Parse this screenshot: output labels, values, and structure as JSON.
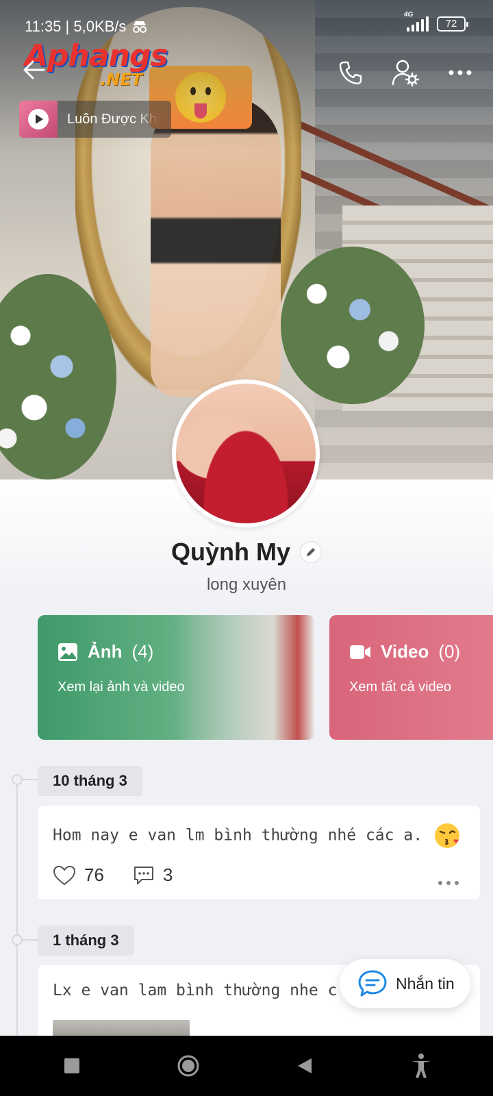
{
  "status_bar": {
    "time_speed": "11:35 | 5,0KB/s",
    "network": "4G",
    "battery": "72"
  },
  "header": {
    "logo_main": "Aphangs",
    "logo_sub": ".NET",
    "music_title": "Luôn Được Khi"
  },
  "profile": {
    "name": "Quỳnh My",
    "location": "long xuyên"
  },
  "cards": {
    "photos": {
      "title": "Ảnh",
      "count": "(4)",
      "subtitle": "Xem lại ảnh và video"
    },
    "videos": {
      "title": "Video",
      "count": "(0)",
      "subtitle": "Xem tất cả video"
    }
  },
  "timeline": [
    {
      "date": "10 tháng 3",
      "text": "Hom nay e van lm bình thường nhé các a.",
      "likes": "76",
      "comments": "3"
    },
    {
      "date": "1 tháng 3",
      "text": "Lx e van lam bình thường nhe c"
    }
  ],
  "message_button": {
    "label": "Nhắn tin"
  },
  "colors": {
    "photos_card": "#3f9a6a",
    "videos_card": "#d9657a",
    "accent": "#1e88e5",
    "nav_bar": "#000000"
  }
}
